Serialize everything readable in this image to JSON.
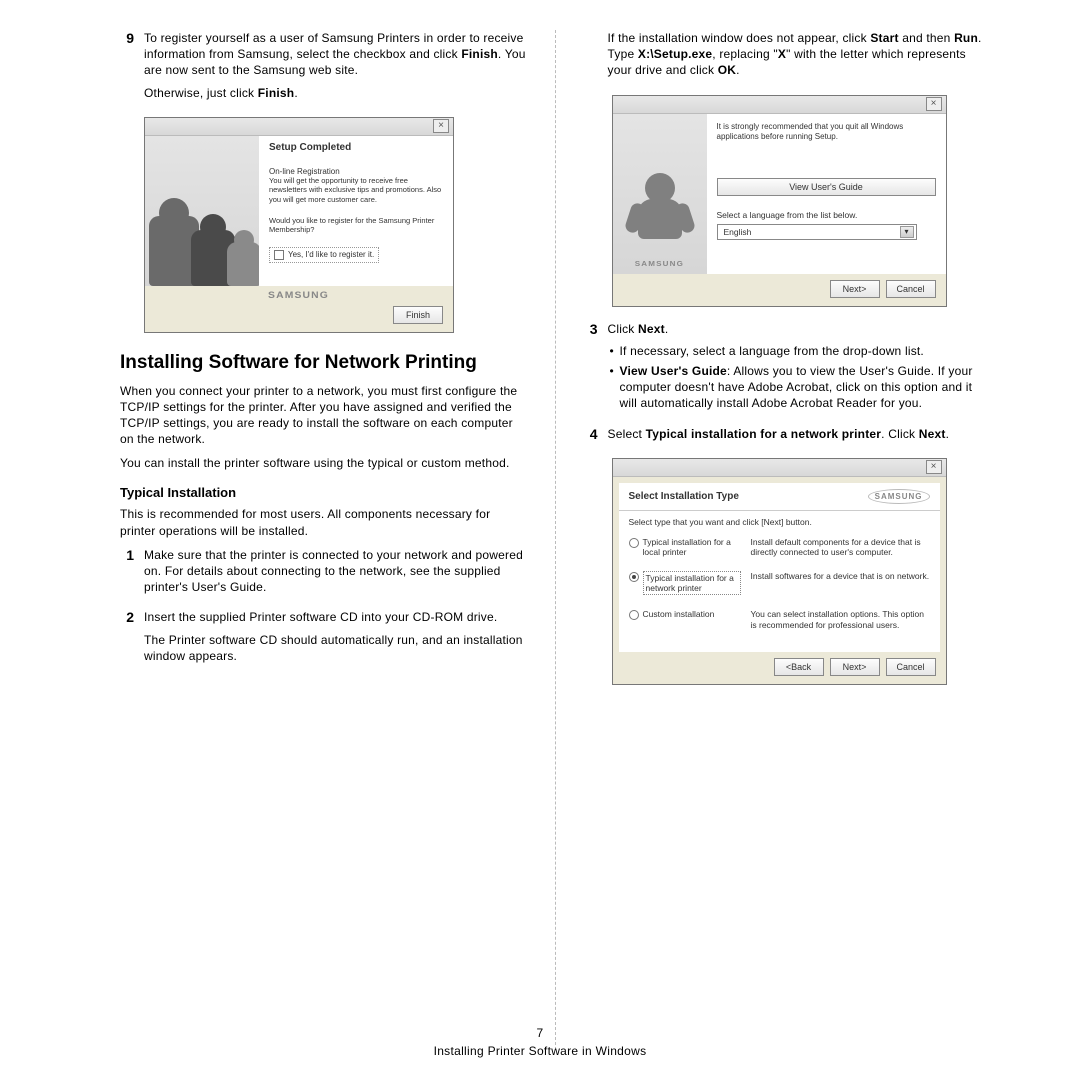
{
  "footer": {
    "page_number": "7",
    "chapter": "Installing Printer Software in Windows"
  },
  "left": {
    "step9": {
      "num": "9",
      "p1_a": "To register yourself as a user of Samsung Printers in order to receive information from Samsung, select the checkbox and click ",
      "p1_b": "Finish",
      "p1_c": ". You are now sent to the Samsung web site.",
      "p2_a": "Otherwise, just click ",
      "p2_b": "Finish",
      "p2_c": "."
    },
    "dlg1": {
      "title": "Setup Completed",
      "onreg_h": "On-line Registration",
      "onreg_t": "You will get the opportunity to receive free newsletters with exclusive tips and promotions. Also you will get more customer care.",
      "q": "Would you like to register for the Samsung Printer Membership?",
      "chk": "Yes, I'd like to register it.",
      "logo": "SAMSUNG",
      "finish_btn": "Finish"
    },
    "heading": "Installing Software for Network Printing",
    "intro1": "When you connect your printer to a network, you must first configure the TCP/IP settings for the printer. After you have assigned and verified the TCP/IP settings, you are ready to install the software on each computer on the network.",
    "intro2": "You can install the printer software using the typical or custom method.",
    "subhead": "Typical Installation",
    "typ_intro": "This is recommended for most users. All components necessary for printer operations will be installed.",
    "step1": {
      "num": "1",
      "t": "Make sure that the printer is connected to your network and powered on. For details about connecting to the network, see the supplied printer's User's Guide."
    },
    "step2": {
      "num": "2",
      "t1": "Insert the supplied Printer software CD into your CD-ROM drive.",
      "t2": "The Printer software CD should automatically run, and an installation window appears."
    }
  },
  "right": {
    "cont": {
      "a": "If the installation window does not appear, click ",
      "start": "Start",
      "b": " and then ",
      "run": "Run",
      "c": ". Type ",
      "path": "X:\\Setup.exe",
      "d": ", replacing \"",
      "x": "X",
      "e": "\" with the letter which represents your drive and click ",
      "ok": "OK",
      "f": "."
    },
    "dlg2": {
      "recommend": "It is strongly recommended that you quit all Windows applications before running Setup.",
      "guide_btn": "View User's Guide",
      "sel_label": "Select a language from the list below.",
      "sel_value": "English",
      "logo": "SAMSUNG",
      "next_btn": "Next>",
      "cancel_btn": "Cancel"
    },
    "step3": {
      "num": "3",
      "t_a": "Click ",
      "t_b": "Next",
      "t_c": ".",
      "bul1": "If necessary, select a language from the drop-down list.",
      "bul2_a": "View User's Guide",
      "bul2_b": ": Allows you to view the User's Guide. If your computer doesn't have Adobe Acrobat, click on this option and it will automatically install Adobe Acrobat Reader for you."
    },
    "step4": {
      "num": "4",
      "a": "Select ",
      "b": "Typical installation for a network printer",
      "c": ". Click ",
      "d": "Next",
      "e": "."
    },
    "dlg3": {
      "hdr": "Select Installation Type",
      "logo": "SAMSUNG",
      "instruct": "Select type that you want and click [Next] button.",
      "opt1_label": "Typical installation for a local printer",
      "opt1_desc": "Install default components for a device that is directly connected to user's computer.",
      "opt2_label": "Typical installation for a network printer",
      "opt2_desc": "Install softwares for a device that is on network.",
      "opt3_label": "Custom installation",
      "opt3_desc": "You can select installation options. This option is recommended for professional users.",
      "back_btn": "<Back",
      "next_btn": "Next>",
      "cancel_btn": "Cancel"
    }
  }
}
